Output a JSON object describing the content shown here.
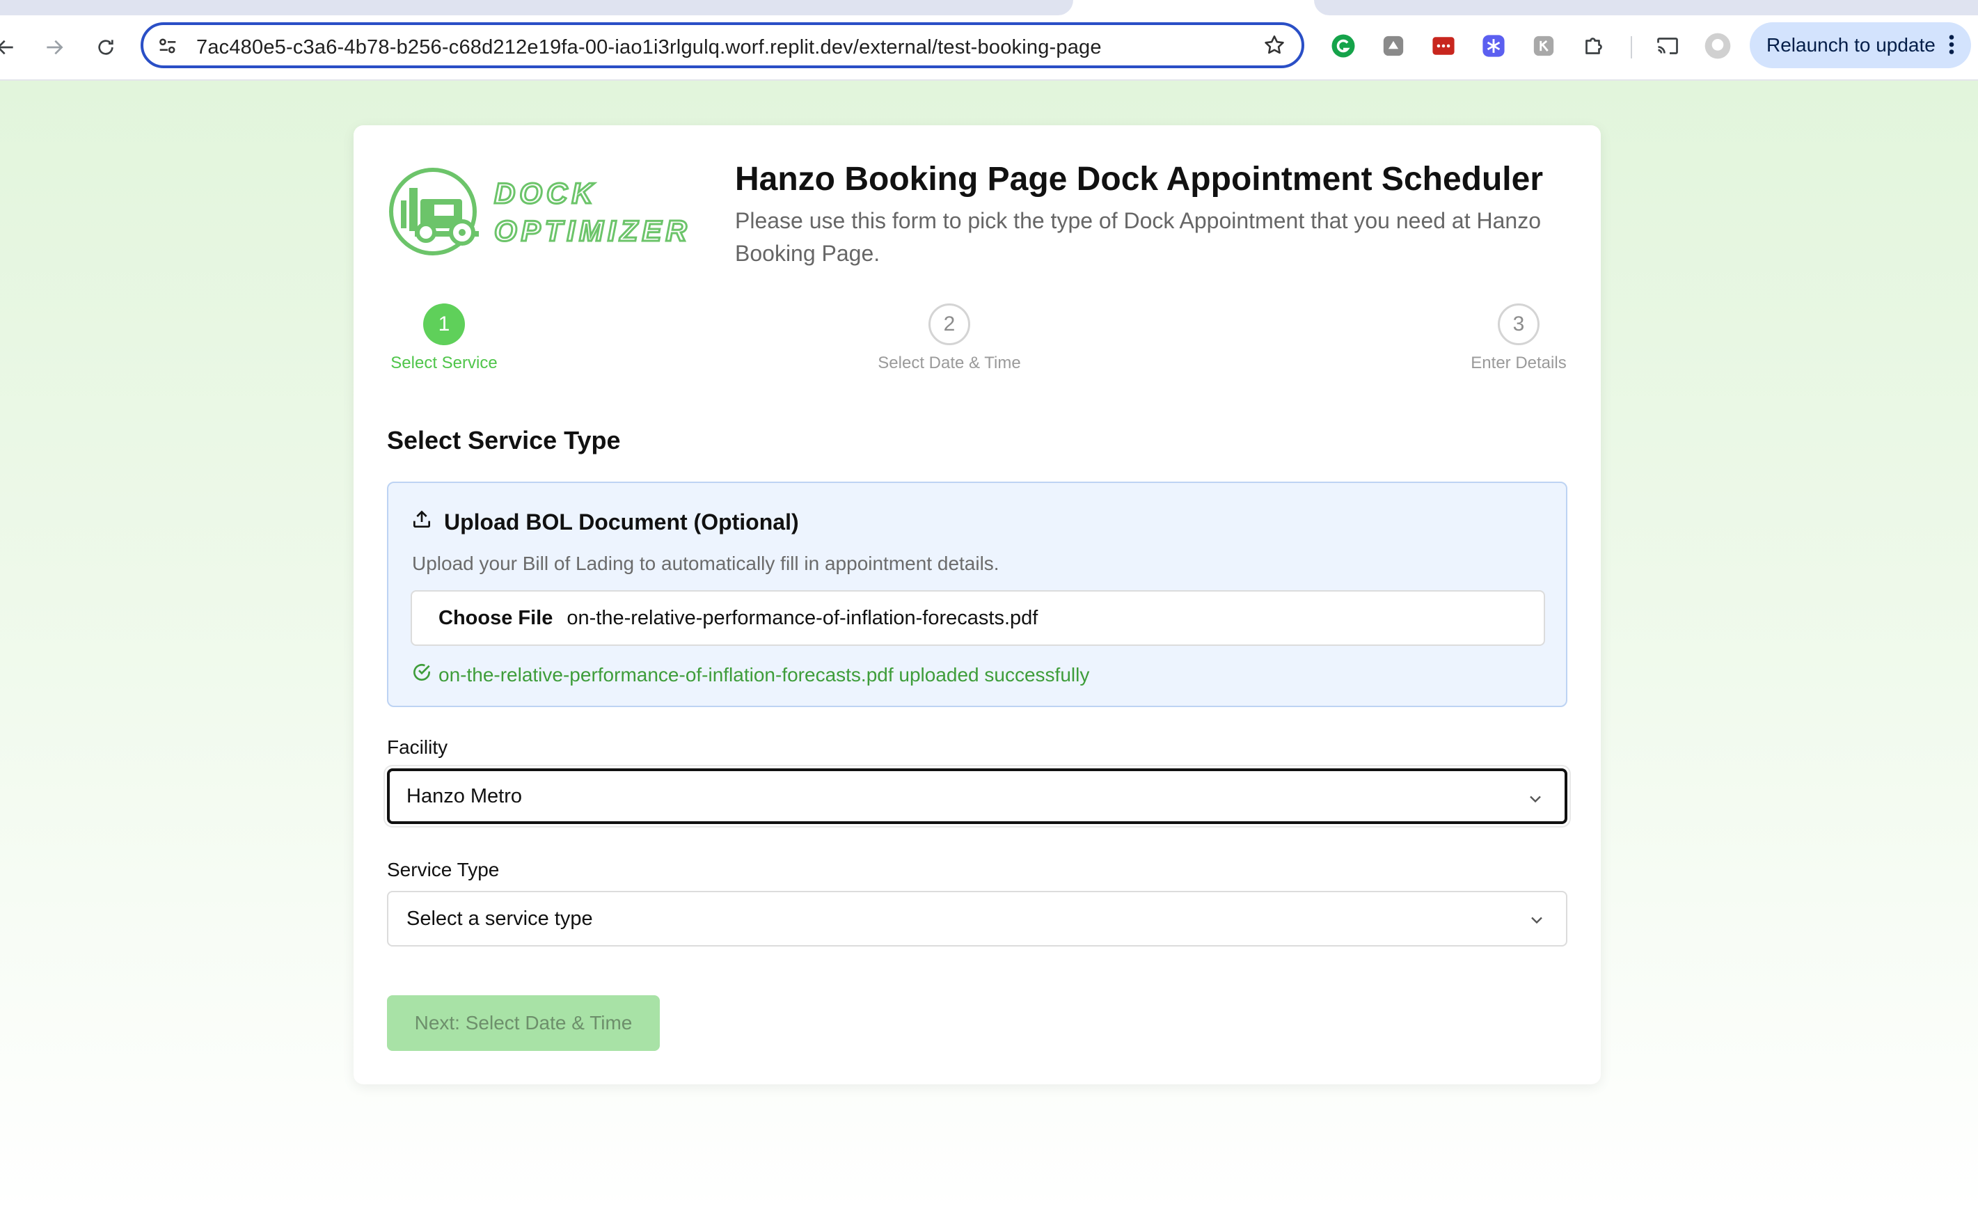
{
  "browser": {
    "url": "7ac480e5-c3a6-4b78-b256-c68d212e19fa-00-iao1i3rlgulq.worf.replit.dev/external/test-booking-page",
    "relaunch_label": "Relaunch to update",
    "extensions": [
      "grammarly-icon",
      "extension-icon",
      "lastpass-icon",
      "snowflake-icon",
      "extension-icon",
      "puzzle-icon"
    ]
  },
  "header": {
    "logo_line1": "DOCK",
    "logo_line2": "OPTIMIZER",
    "title": "Hanzo Booking Page Dock Appointment Scheduler",
    "subtitle": "Please use this form to pick the type of Dock Appointment that you need at Hanzo Booking Page."
  },
  "steps": [
    {
      "number": "1",
      "label": "Select Service",
      "active": true
    },
    {
      "number": "2",
      "label": "Select Date & Time",
      "active": false
    },
    {
      "number": "3",
      "label": "Enter Details",
      "active": false
    }
  ],
  "form": {
    "section_title": "Select Service Type",
    "upload": {
      "title": "Upload BOL Document (Optional)",
      "description": "Upload your Bill of Lading to automatically fill in appointment details.",
      "choose_label": "Choose File",
      "file_name": "on-the-relative-performance-of-inflation-forecasts.pdf",
      "success_message": "on-the-relative-performance-of-inflation-forecasts.pdf uploaded successfully"
    },
    "facility": {
      "label": "Facility",
      "value": "Hanzo Metro"
    },
    "service_type": {
      "label": "Service Type",
      "placeholder": "Select a service type"
    },
    "next_button": "Next: Select Date & Time"
  },
  "colors": {
    "brand_green": "#5fd05a",
    "success_green": "#3e9d3a",
    "focus_blue": "#2a4fc6",
    "disabled_button": "#a8e2a6"
  }
}
